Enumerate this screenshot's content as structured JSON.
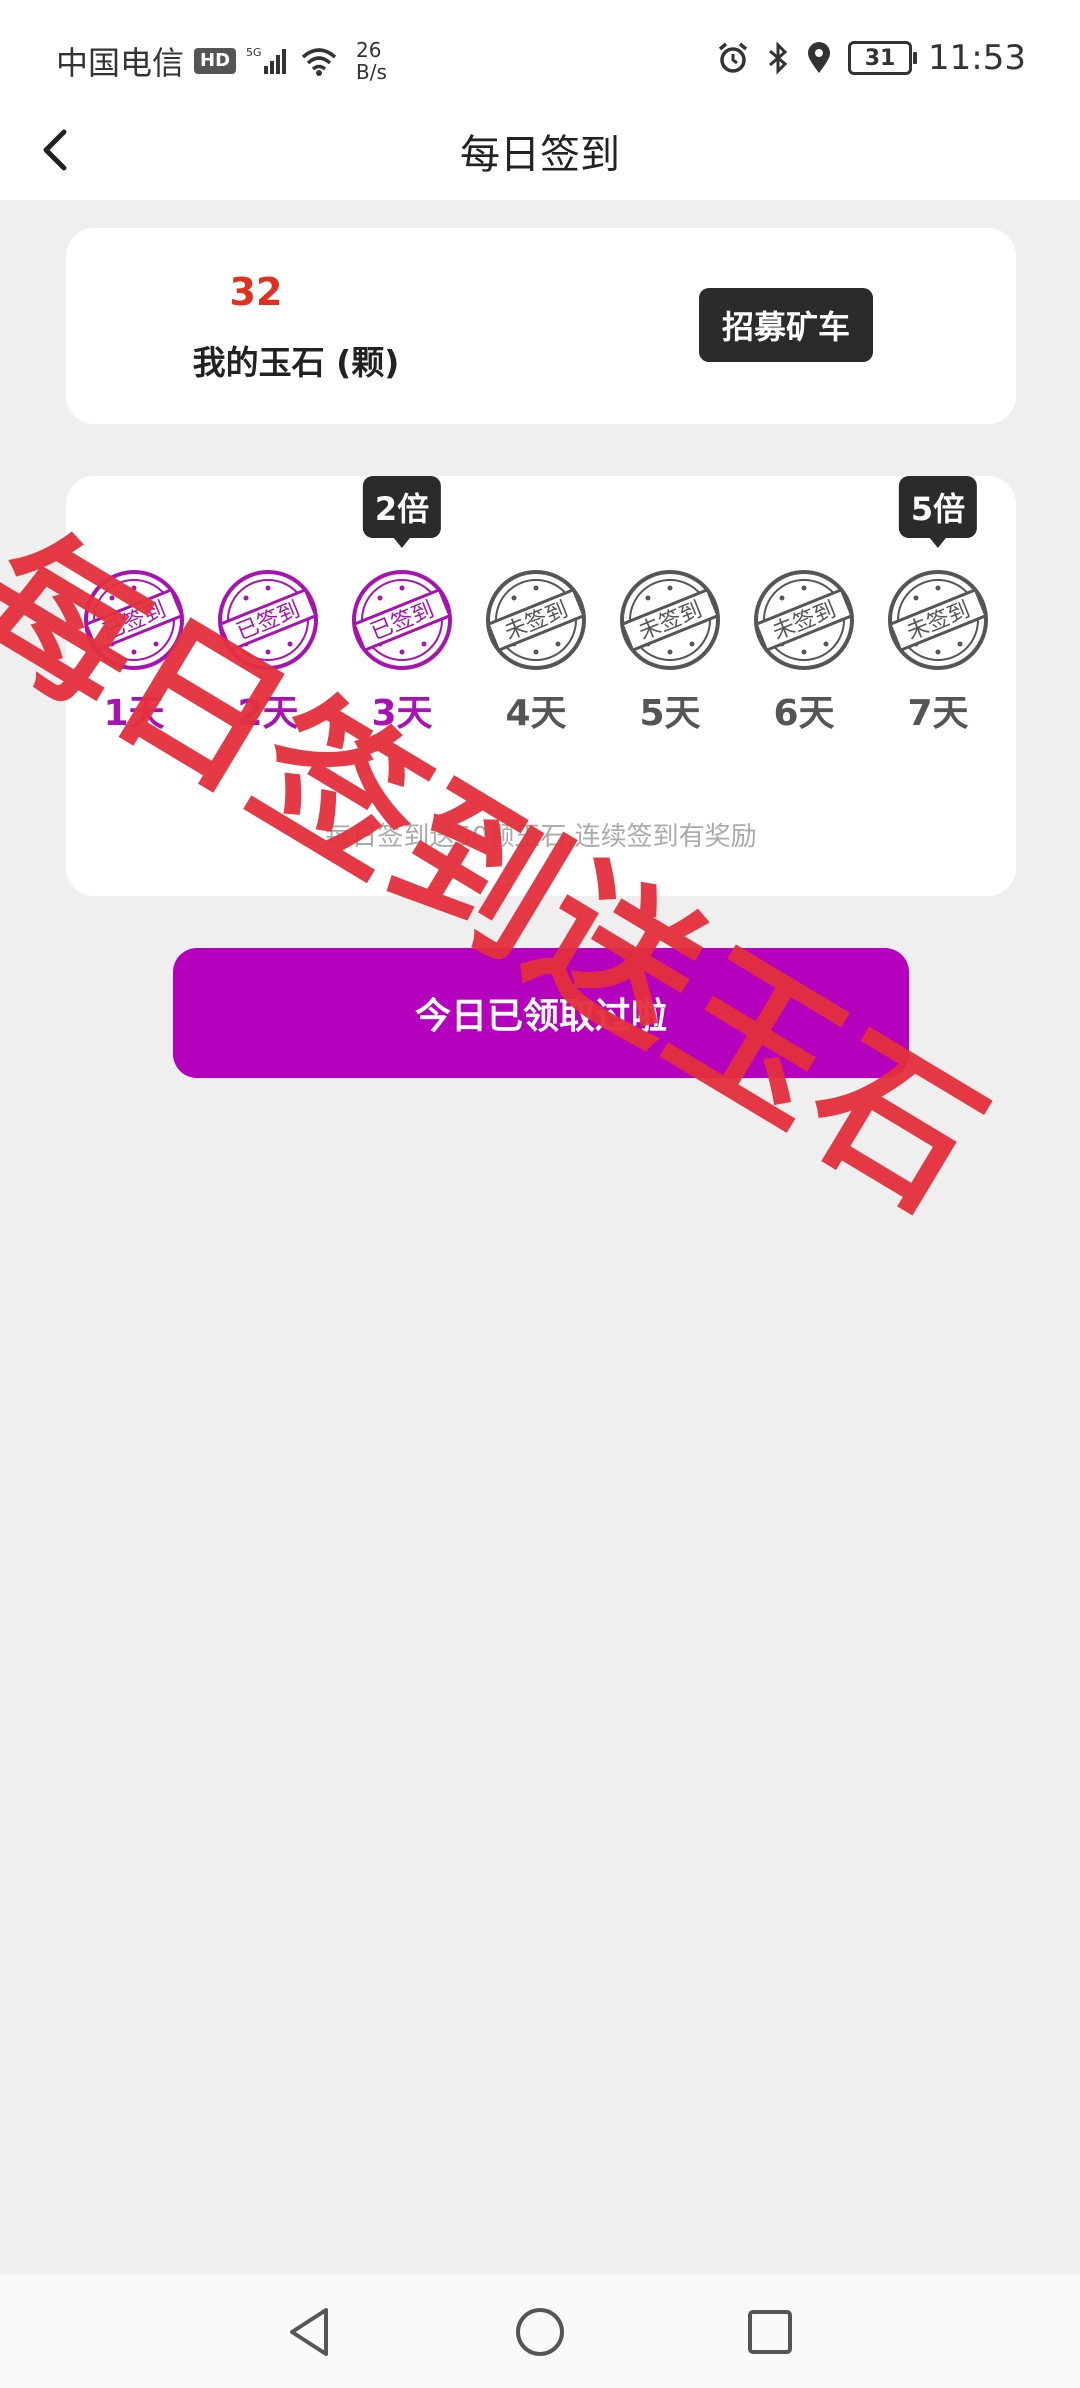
{
  "status_bar": {
    "carrier": "中国电信",
    "hd_badge": "HD",
    "network": "5G",
    "speed_value": "26",
    "speed_unit": "B/s",
    "battery": "31",
    "time": "11:53"
  },
  "nav": {
    "title": "每日签到"
  },
  "jade": {
    "count": "32",
    "label": "我的玉石 (颗)",
    "recruit_button": "招募矿车"
  },
  "checkin": {
    "days": [
      {
        "label": "1天",
        "signed": true,
        "stamp_text": "已签到"
      },
      {
        "label": "2天",
        "signed": true,
        "stamp_text": "已签到"
      },
      {
        "label": "3天",
        "signed": true,
        "stamp_text": "已签到",
        "bonus": "2倍"
      },
      {
        "label": "4天",
        "signed": false,
        "stamp_text": "未签到"
      },
      {
        "label": "5天",
        "signed": false,
        "stamp_text": "未签到"
      },
      {
        "label": "6天",
        "signed": false,
        "stamp_text": "未签到"
      },
      {
        "label": "7天",
        "signed": false,
        "stamp_text": "未签到",
        "bonus": "5倍"
      }
    ],
    "hint": "每日签到送50颗玉石,连续签到有奖励"
  },
  "claim_button": "今日已领取过啦",
  "watermark": "每日签到送玉石",
  "colors": {
    "signed": "#a812b3",
    "unsigned": "#555555",
    "claim_bg": "#b500bd",
    "jade_count": "#e0311c",
    "watermark": "#e4303c"
  }
}
